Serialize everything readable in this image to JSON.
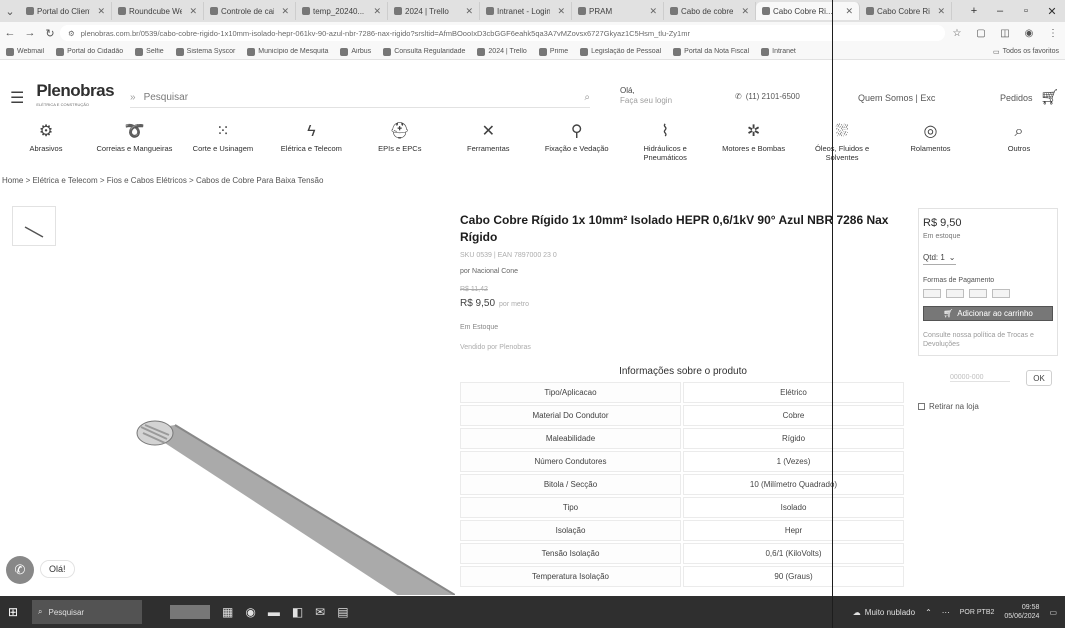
{
  "browser": {
    "tabs": [
      {
        "title": "Portal do Cliente"
      },
      {
        "title": "Roundcube Webmail"
      },
      {
        "title": "Controle de caixa"
      },
      {
        "title": "temp_20240..."
      },
      {
        "title": "2024 | Trello"
      },
      {
        "title": "Intranet - Login"
      },
      {
        "title": "PRAM"
      },
      {
        "title": "Cabo de cobre"
      },
      {
        "title": "Cabo Cobre Ri..."
      },
      {
        "title": "Cabo Cobre Ri..."
      }
    ],
    "new_tab": "+",
    "url": "plenobras.com.br/0539/cabo-cobre-rigido-1x10mm-isolado-hepr-061kv-90-azul-nbr-7286-nax-rigido?srsltid=AfmBOooIxD3cbGGF6eahk5qa3A7vMZovsx6727Gkyaz1C5Hsm_tlu-Zy1mr",
    "bookmarks": [
      "Webmail",
      "Portal do Cidadão",
      "Selfie",
      "Sistema Syscor",
      "Município de Mesquita",
      "Airbus",
      "Consulta Regularidade",
      "2024 | Trello",
      "Prime",
      "Legislação de Pessoal",
      "Portal da Nota Fiscal",
      "Intranet"
    ],
    "all_bookmarks": "Todos os favoritos"
  },
  "site": {
    "logo": "Plenobras",
    "logo_tagline": "ELÉTRICA E CONSTRUÇÃO",
    "search_placeholder": "Pesquisar",
    "greeting": "Olá,",
    "login_prompt": "Faça seu login",
    "phone": "(11) 2101-6500",
    "about": "Quem Somos | Exc",
    "orders": "Pedidos"
  },
  "categories": [
    {
      "label": "Abrasivos",
      "icon": "gear-icon"
    },
    {
      "label": "Correias e Mangueiras",
      "icon": "hose-icon"
    },
    {
      "label": "Corte e Usinagem",
      "icon": "grid-icon"
    },
    {
      "label": "Elétrica e Telecom",
      "icon": "bolt-icon"
    },
    {
      "label": "EPIs e EPCs",
      "icon": "helmet-icon"
    },
    {
      "label": "Ferramentas",
      "icon": "tools-icon"
    },
    {
      "label": "Fixação e Vedação",
      "icon": "screw-icon"
    },
    {
      "label": "Hidráulicos e Pneumáticos",
      "icon": "pipe-icon"
    },
    {
      "label": "Motores e Bombas",
      "icon": "fan-icon"
    },
    {
      "label": "Óleos, Fluidos e Solventes",
      "icon": "drop-icon"
    },
    {
      "label": "Rolamentos",
      "icon": "bearing-icon"
    },
    {
      "label": "Outros",
      "icon": "search-icon"
    }
  ],
  "breadcrumb": "Home > Elétrica e Telecom > Fios e Cabos Elétricos > Cabos de Cobre Para Baixa Tensão",
  "product": {
    "title": "Cabo Cobre Rígido 1x 10mm² Isolado HEPR 0,6/1kV 90° Azul NBR 7286 Nax Rígido",
    "sku": "SKU 0539 | EAN 7897000 23 0",
    "brand": "por Nacional Cone",
    "old_price": "R$ 11,42",
    "price": "R$ 9,50",
    "price_unit": "por metro",
    "stock": "Em Estoque",
    "seller": "Vendido por Plenobras"
  },
  "sidebar": {
    "price": "R$ 9,50",
    "stock": "Em estoque",
    "qty": "Qtd: 1",
    "payment_label": "Formas de Pagamento",
    "payment_icons": [
      "visa-icon",
      "mastercard-icon",
      "elo-icon",
      "amex-icon"
    ],
    "add_to_cart": "Adicionar ao carrinho",
    "policy": "Consulte nossa política de Trocas e Devoluções",
    "cep_placeholder": "00000-000",
    "ok": "OK",
    "pickup": "Retirar na loja"
  },
  "specs": {
    "title": "Informações sobre o produto",
    "rows": [
      {
        "k": "Tipo/Aplicacao",
        "v": "Elétrico"
      },
      {
        "k": "Material Do Condutor",
        "v": "Cobre"
      },
      {
        "k": "Maleabilidade",
        "v": "Rígido"
      },
      {
        "k": "Número Condutores",
        "v": "1 (Vezes)"
      },
      {
        "k": "Bitola / Secção",
        "v": "10 (Milímetro Quadrado)"
      },
      {
        "k": "Tipo",
        "v": "Isolado"
      },
      {
        "k": "Isolação",
        "v": "Hepr"
      },
      {
        "k": "Tensão Isolação",
        "v": "0,6/1 (KiloVolts)"
      },
      {
        "k": "Temperatura Isolação",
        "v": "90 (Graus)"
      }
    ]
  },
  "chat": {
    "bubble": "Olá!"
  },
  "taskbar": {
    "search": "Pesquisar",
    "weather": "Muito nublado",
    "lang": "POR PTB2",
    "time": "09:58",
    "date": "05/06/2024"
  }
}
